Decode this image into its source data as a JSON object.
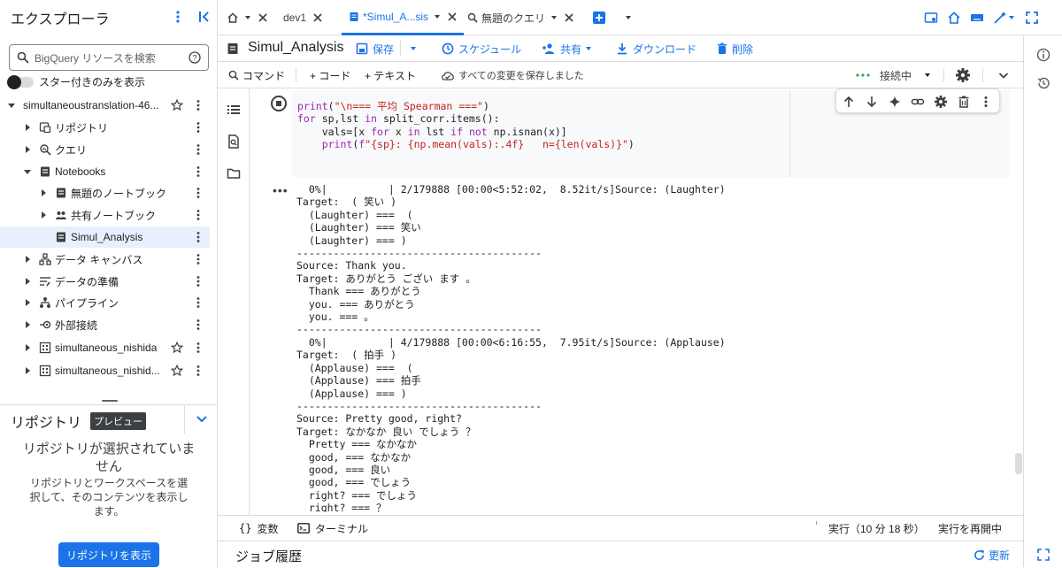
{
  "explorer": {
    "title": "エクスプローラ",
    "search_placeholder": "BigQuery リソースを検索",
    "starred_only": "スター付きのみを表示"
  },
  "tree": [
    {
      "label": "simultaneoustranslation-46...",
      "depth": 0,
      "arrow": "down",
      "icon": "",
      "star": true
    },
    {
      "label": "リポジトリ",
      "depth": 1,
      "arrow": "right",
      "icon": "repo",
      "star": false
    },
    {
      "label": "クエリ",
      "depth": 1,
      "arrow": "right",
      "icon": "query",
      "star": false
    },
    {
      "label": "Notebooks",
      "depth": 1,
      "arrow": "down",
      "icon": "notebook",
      "star": false
    },
    {
      "label": "無題のノートブック",
      "depth": 2,
      "arrow": "right",
      "icon": "notebook",
      "star": false
    },
    {
      "label": "共有ノートブック",
      "depth": 2,
      "arrow": "right",
      "icon": "shared",
      "star": false
    },
    {
      "label": "Simul_Analysis",
      "depth": 2,
      "arrow": "",
      "icon": "notebook",
      "star": false,
      "selected": true
    },
    {
      "label": "データ キャンバス",
      "depth": 1,
      "arrow": "right",
      "icon": "canvas",
      "star": false
    },
    {
      "label": "データの準備",
      "depth": 1,
      "arrow": "right",
      "icon": "prep",
      "star": false
    },
    {
      "label": "パイプライン",
      "depth": 1,
      "arrow": "right",
      "icon": "pipeline",
      "star": false
    },
    {
      "label": "外部接続",
      "depth": 1,
      "arrow": "right",
      "icon": "external",
      "star": false
    },
    {
      "label": "simultaneous_nishida",
      "depth": 1,
      "arrow": "right",
      "icon": "dataset",
      "star": true
    },
    {
      "label": "simultaneous_nishid...",
      "depth": 1,
      "arrow": "right",
      "icon": "dataset",
      "star": true
    }
  ],
  "repo": {
    "title": "リポジトリ",
    "badge": "プレビュー",
    "empty_title": "リポジトリが選択されていません",
    "empty_desc": "リポジトリとワークスペースを選択して、そのコンテンツを表示します。",
    "button": "リポジトリを表示"
  },
  "tabs": [
    {
      "label": "dev1"
    },
    {
      "label": "*Simul_A...sis"
    },
    {
      "label": "無題のクエリ"
    }
  ],
  "notebook": {
    "title": "Simul_Analysis",
    "save": "保存",
    "schedule": "スケジュール",
    "share": "共有",
    "download": "ダウンロード",
    "delete": "削除"
  },
  "celltoolbar": {
    "command": "コマンド",
    "code": "+ コード",
    "text": "+ テキスト",
    "saved": "すべての変更を保存しました",
    "connection": "接続中"
  },
  "code_lines": [
    "print(\"\\n=== 平均 Spearman ===\")",
    "for sp,lst in split_corr.items():",
    "    vals=[x for x in lst if not np.isnan(x)]",
    "    print(f\"{sp}: {np.mean(vals):.4f}   n={len(vals)}\")"
  ],
  "output_lines": [
    "  0%|          | 2/179888 [00:00<5:52:02,  8.52it/s]Source: (Laughter)",
    "Target:  ( 笑い )",
    "  (Laughter) ===  (",
    "  (Laughter) === 笑い",
    "  (Laughter) === )",
    "----------------------------------------",
    "Source: Thank you.",
    "Target: ありがとう ござい ます 。",
    "  Thank === ありがとう",
    "  you. === ありがとう",
    "  you. === 。",
    "----------------------------------------",
    "  0%|          | 4/179888 [00:00<6:16:55,  7.95it/s]Source: (Applause)",
    "Target:  ( 拍手 )",
    "  (Applause) ===  (",
    "  (Applause) === 拍手",
    "  (Applause) === )",
    "----------------------------------------",
    "Source: Pretty good, right?",
    "Target: なかなか 良い でしょう ？",
    "  Pretty === なかなか",
    "  good, === なかなか",
    "  good, === 良い",
    "  good, === でしょう",
    "  right? === でしょう",
    "  right? === ？"
  ],
  "statusbar": {
    "variables": "変数",
    "terminal": "ターミナル",
    "running": "実行（10 分 18 秒）",
    "restart": "実行を再開中"
  },
  "jobs": {
    "title": "ジョブ履歴",
    "refresh": "更新"
  },
  "colors": {
    "accent": "#1a73e8",
    "connected": "#34a853"
  }
}
